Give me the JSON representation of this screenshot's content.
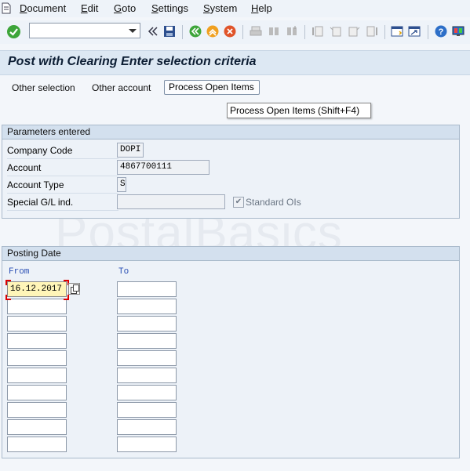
{
  "menu": {
    "icon": "session-menu-icon",
    "items": [
      {
        "label": "Document"
      },
      {
        "label": "Edit"
      },
      {
        "label": "Goto"
      },
      {
        "label": "Settings"
      },
      {
        "label": "System"
      },
      {
        "label": "Help"
      }
    ]
  },
  "toolbar": {
    "command_field_value": "",
    "icons": [
      "enter-icon",
      "command-dropdown-icon",
      "collapse-icon",
      "save-icon",
      "back-icon",
      "exit-icon",
      "cancel-icon",
      "print-icon",
      "find-icon",
      "find-next-icon",
      "first-page-icon",
      "previous-page-icon",
      "next-page-icon",
      "last-page-icon",
      "create-session-icon",
      "shortcut-icon",
      "help-icon",
      "customize-layout-icon"
    ]
  },
  "title": "Post with Clearing Enter selection criteria",
  "app_toolbar": {
    "other_selection": "Other selection",
    "other_account": "Other account",
    "process_open_items": "Process Open Items",
    "tooltip": "Process Open Items   (Shift+F4)"
  },
  "parameters": {
    "heading": "Parameters entered",
    "company_code_label": "Company Code",
    "company_code_value": "DOPI",
    "account_label": "Account",
    "account_value": "4867700111",
    "account_type_label": "Account Type",
    "account_type_value": "S",
    "special_gl_label": "Special G/L ind.",
    "special_gl_value": "",
    "standard_ois_label": "Standard OIs",
    "standard_ois_checked": true
  },
  "posting_date": {
    "heading": "Posting Date",
    "from_label": "From",
    "to_label": "To",
    "from_values": [
      "16.12.2017",
      "",
      "",
      "",
      "",
      "",
      "",
      "",
      "",
      ""
    ],
    "to_values": [
      "",
      "",
      "",
      "",
      "",
      "",
      "",
      "",
      "",
      ""
    ]
  },
  "watermark": "PostalBasics",
  "colors": {
    "accent_blue": "#2a4fb4",
    "active_field": "#fff5b8",
    "focus_marker": "#dd0000"
  }
}
